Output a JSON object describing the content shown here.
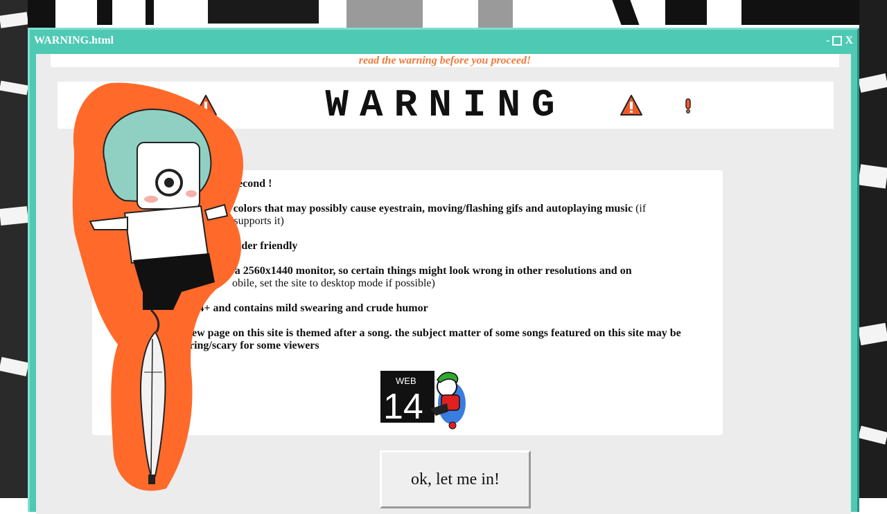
{
  "window": {
    "title": "WARNING.html",
    "minimize": "-",
    "close": "X"
  },
  "top_note": "read the warning before you proceed!",
  "banner": {
    "title": "WARNING"
  },
  "warnings": [
    {
      "bold": "d read for a second !",
      "normal": ""
    },
    {
      "bold": "tains bright colors that may possibly cause eyestrain, moving/flashing gifs and autoplaying music",
      "normal": " (if",
      "line2": "er supports it)"
    },
    {
      "bold": "not screen reader friendly",
      "normal": ""
    },
    {
      "bold": "s made with a 2560x1440 monitor, so certain things might look wrong in other resolutions and on",
      "normal": "",
      "line2": "obile, set the site to desktop mode if possible)"
    },
    {
      "bold": "ted 14+ and contains mild swearing and crude humor",
      "normal": ""
    },
    {
      "bold": "each new page on this site is themed after a song. the subject matter of some songs featured on this site may be",
      "normal": "",
      "line2": "triggering/scary for some viewers"
    }
  ],
  "badge": {
    "top": "WEB",
    "number": "14"
  },
  "enter_button": "ok, let me in!",
  "colors": {
    "titlebar": "#4ec9b4",
    "accent": "#ef7c3c",
    "warning_icon": "#f05a28",
    "mascot_outline": "#ff6a2b"
  }
}
